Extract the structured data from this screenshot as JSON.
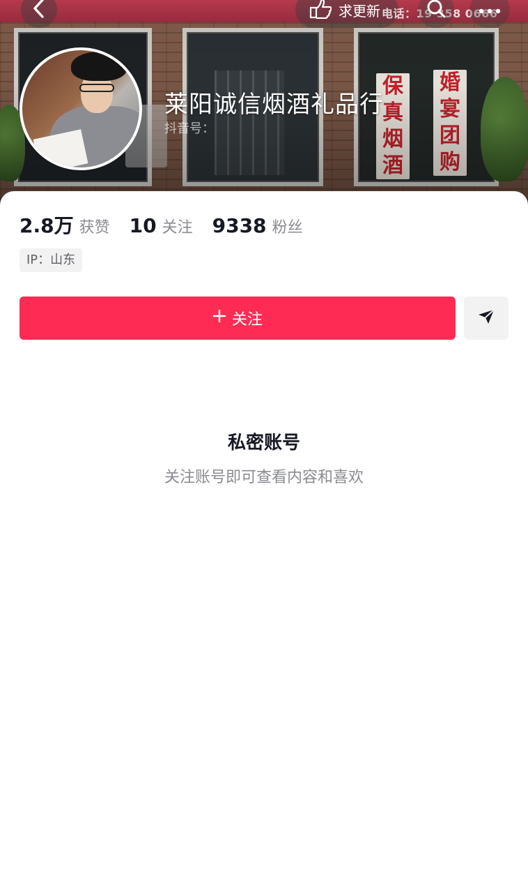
{
  "header": {
    "request_update_label": "求更新",
    "phone_text": "电话：19 358 0666",
    "icons": [
      "back-icon",
      "pointing-hand-icon",
      "search-icon",
      "more-icon"
    ]
  },
  "banner": {
    "poster_left": [
      "保",
      "真",
      "烟",
      "酒"
    ],
    "poster_right": [
      "婚",
      "宴",
      "团",
      "购"
    ]
  },
  "profile": {
    "nickname": "莱阳诚信烟酒礼品行",
    "douyin_id_label": "抖音号："
  },
  "stats": [
    {
      "value": "2.8万",
      "label": "获赞"
    },
    {
      "value": "10",
      "label": "关注"
    },
    {
      "value": "9338",
      "label": "粉丝"
    }
  ],
  "ip_tag": "IP：山东",
  "actions": {
    "follow_label": "关注",
    "follow_color": "#fe2c55",
    "share_icon": "send-icon"
  },
  "private": {
    "title": "私密账号",
    "subtitle": "关注账号即可查看内容和喜欢"
  }
}
